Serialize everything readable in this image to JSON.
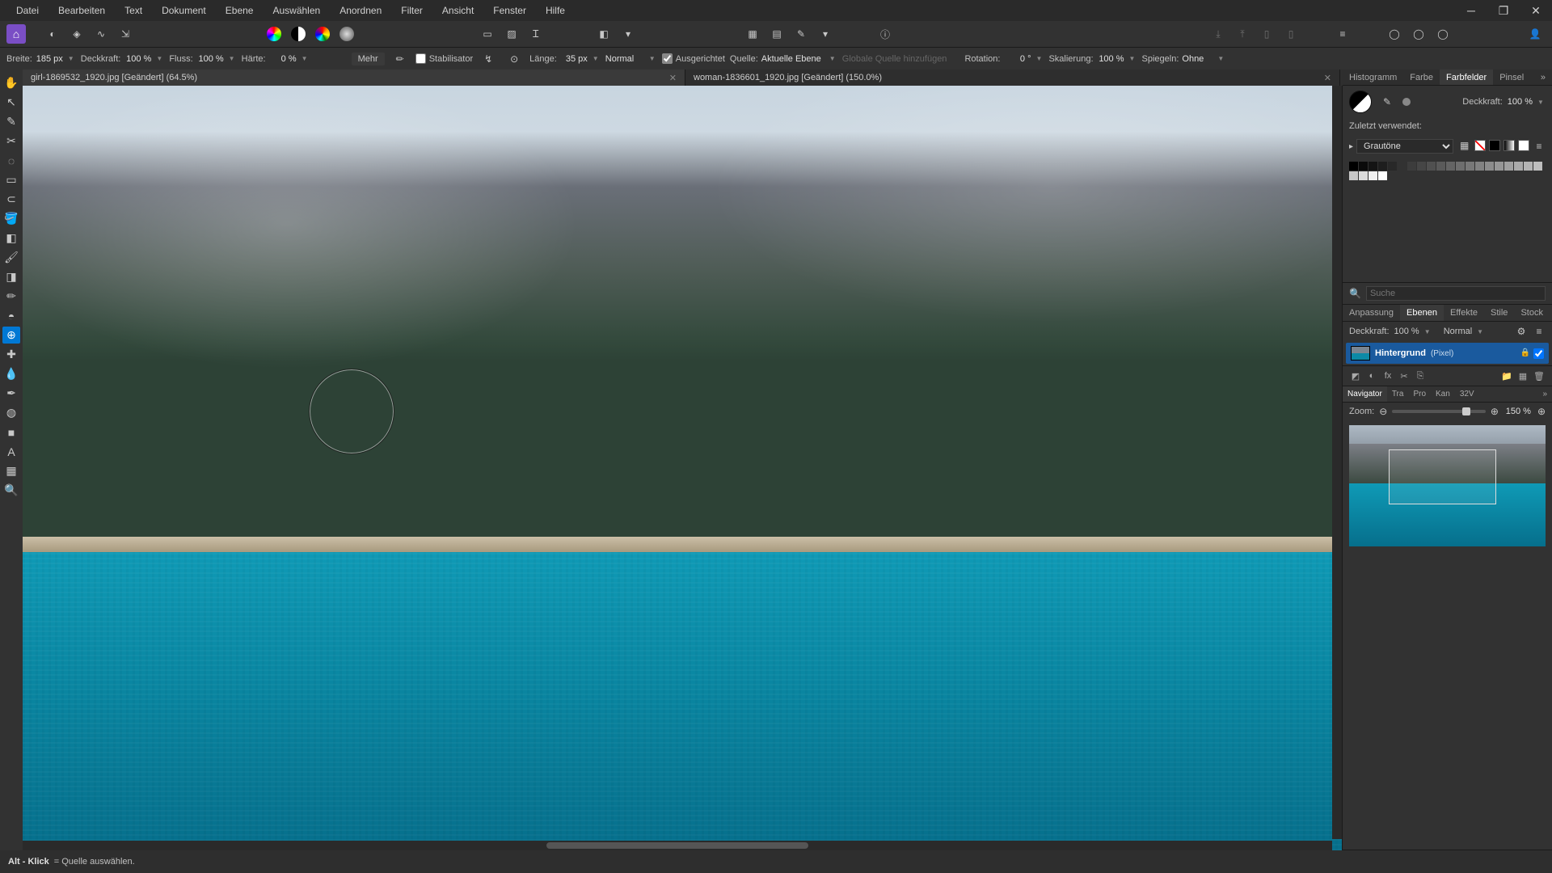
{
  "menubar": [
    "Datei",
    "Bearbeiten",
    "Text",
    "Dokument",
    "Ebene",
    "Auswählen",
    "Anordnen",
    "Filter",
    "Ansicht",
    "Fenster",
    "Hilfe"
  ],
  "ctx": {
    "breite_label": "Breite:",
    "breite_value": "185 px",
    "deckkraft_label": "Deckkraft:",
    "deckkraft_value": "100 %",
    "fluss_label": "Fluss:",
    "fluss_value": "100 %",
    "haerte_label": "Härte:",
    "haerte_value": "0 %",
    "mehr": "Mehr",
    "stabilisator": "Stabilisator",
    "laenge_label": "Länge:",
    "laenge_value": "35 px",
    "blendmode": "Normal",
    "ausgerichtet": "Ausgerichtet",
    "quelle_label": "Quelle:",
    "quelle_value": "Aktuelle Ebene",
    "globale": "Globale Quelle hinzufügen",
    "rotation_label": "Rotation:",
    "rotation_value": "0 °",
    "skalierung_label": "Skalierung:",
    "skalierung_value": "100 %",
    "spiegeln_label": "Spiegeln:",
    "spiegeln_value": "Ohne"
  },
  "tabs": [
    {
      "label": "girl-1869532_1920.jpg [Geändert] (64.5%)",
      "active": true
    },
    {
      "label": "woman-1836601_1920.jpg [Geändert] (150.0%)",
      "active": false
    }
  ],
  "right_top_tabs": [
    "Histogramm",
    "Farbe",
    "Farbfelder",
    "Pinsel"
  ],
  "right_top_active": 2,
  "swatches": {
    "opacity_label": "Deckkraft:",
    "opacity_value": "100 %",
    "recent_label": "Zuletzt verwendet:",
    "preset": "Grautöne"
  },
  "search": {
    "placeholder": "Suche"
  },
  "midtabs": [
    "Anpassung",
    "Ebenen",
    "Effekte",
    "Stile",
    "Stock"
  ],
  "midtabs_active": 1,
  "layers": {
    "opacity_label": "Deckkraft:",
    "opacity_value": "100 %",
    "mode": "Normal",
    "item_name": "Hintergrund",
    "item_type": "(Pixel)"
  },
  "navtabs": [
    "Navigator",
    "Tra",
    "Pro",
    "Kan",
    "32V"
  ],
  "navtabs_active": 0,
  "navigator": {
    "zoom_label": "Zoom:",
    "zoom_value": "150 %"
  },
  "status": {
    "key": "Alt - Klick",
    "desc": "= Quelle auswählen."
  }
}
